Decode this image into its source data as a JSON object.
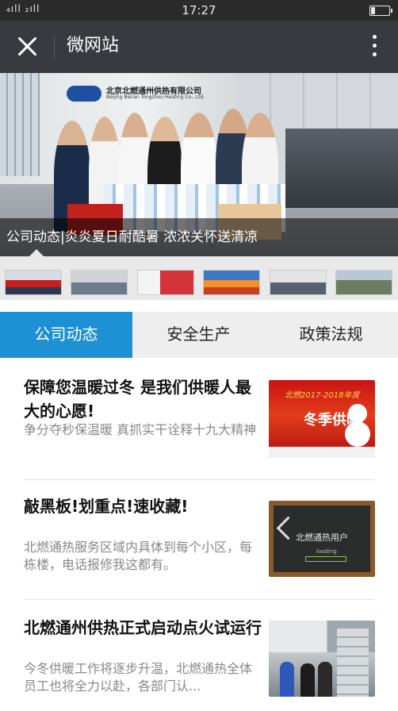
{
  "status_bar": {
    "signal": "₄ıll ₂ıll",
    "time": "17:27"
  },
  "app_bar": {
    "title": "微网站"
  },
  "hero": {
    "sign_name": "北京北燃通州供热有限公司",
    "sign_en": "Beijing Beiran Tongzhou Heating Co., Ltd.",
    "logo_text": "北燃通州供热",
    "caption": "公司动态|炎炎夏日耐酷暑 浓浓关怀送清凉"
  },
  "tabs": [
    {
      "label": "公司动态",
      "active": true
    },
    {
      "label": "安全生产",
      "active": false
    },
    {
      "label": "政策法规",
      "active": false
    }
  ],
  "articles": [
    {
      "title": "保障您温暖过冬 是我们供暖人最大的心愿!",
      "desc": "争分夺秒保温暖 真抓实干诠释十九大精神",
      "image_text": "冬季供暖",
      "image_subtext": "北燃2017-2018年度"
    },
    {
      "title": "敲黑板!划重点!速收藏!",
      "desc": "北燃通热服务区域内具体到每个小区，每栋楼，电话报修我这都有。",
      "image_text": "北燃通热用户",
      "image_subtext": "loading"
    },
    {
      "title": "北燃通州供热正式启动点火试运行",
      "desc": "今冬供暖工作将逐步升温，北燃通热全体员工也将全力以赴，各部门认...",
      "image_text": ""
    }
  ],
  "colors": {
    "accent": "#1e90d4",
    "appbar": "#393a3f"
  }
}
